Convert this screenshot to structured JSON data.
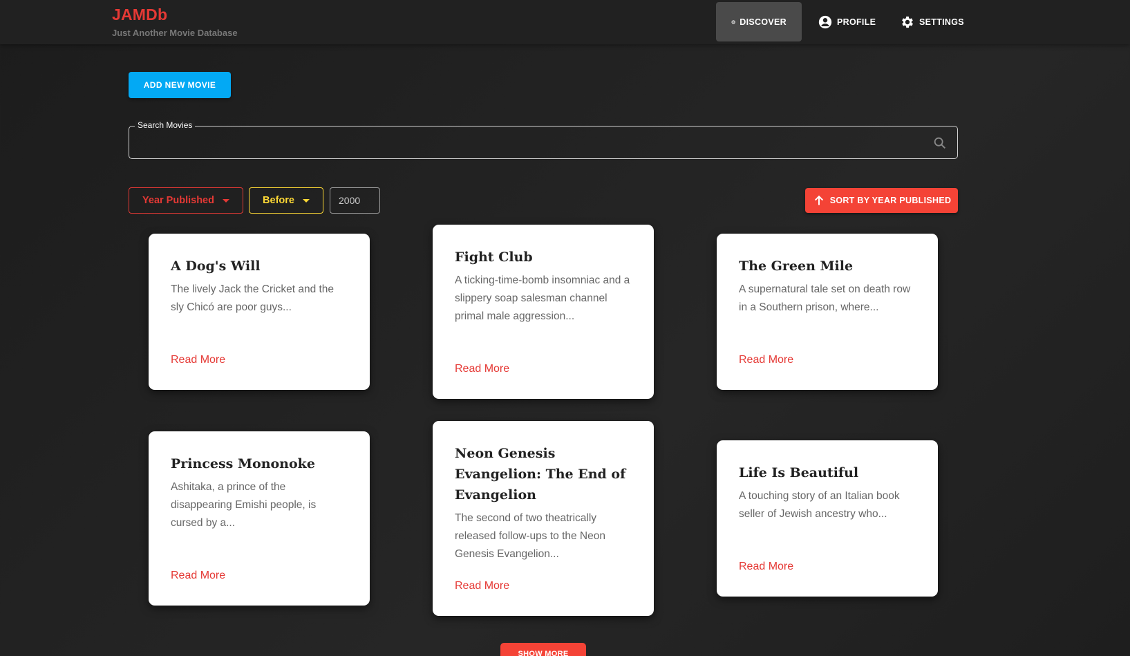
{
  "header": {
    "title": "JAMDb",
    "subtitle": "Just Another Movie Database",
    "nav": [
      {
        "label": "DISCOVER",
        "icon": "globe-icon"
      },
      {
        "label": "PROFILE",
        "icon": "account-circle-icon"
      },
      {
        "label": "SETTINGS",
        "icon": "gear-icon"
      }
    ]
  },
  "toolbar": {
    "add_label": "ADD NEW MOVIE"
  },
  "search": {
    "label": "Search Movies",
    "value": "",
    "placeholder": ""
  },
  "filters": {
    "field": "Year Published",
    "comparator": "Before",
    "year_value": "2000",
    "sort_label": "SORT BY YEAR PUBLISHED"
  },
  "movies": [
    {
      "title": "A Dog's Will",
      "description": "The lively Jack the Cricket and the sly Chicó are poor guys...",
      "link": "Read More"
    },
    {
      "title": "Fight Club",
      "description": "A ticking-time-bomb insomniac and a slippery soap salesman channel primal male aggression...",
      "link": "Read More"
    },
    {
      "title": "The Green Mile",
      "description": "A supernatural tale set on death row in a Southern prison, where...",
      "link": "Read More"
    },
    {
      "title": "Princess Mononoke",
      "description": "Ashitaka, a prince of the disappearing Emishi people, is cursed by a...",
      "link": "Read More"
    },
    {
      "title": "Neon Genesis Evangelion: The End of Evangelion",
      "description": "The second of two theatrically released follow-ups to the Neon Genesis Evangelion...",
      "link": "Read More"
    },
    {
      "title": "Life Is Beautiful",
      "description": "A touching story of an Italian book seller of Jewish ancestry who...",
      "link": "Read More"
    }
  ],
  "footer": {
    "show_more_label": "SHOW MORE"
  },
  "colors": {
    "brand": "#e53935",
    "primary_button": "#03a9f4",
    "accent_button": "#f44336",
    "filter_yellow": "#fdd835"
  }
}
